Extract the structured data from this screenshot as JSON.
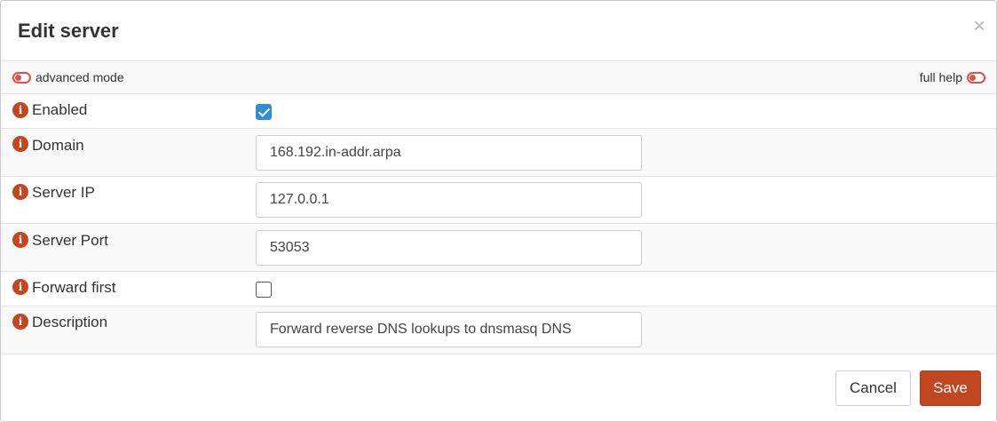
{
  "dialog": {
    "title": "Edit server",
    "close_glyph": "×"
  },
  "mode_bar": {
    "advanced_mode_label": "advanced mode",
    "full_help_label": "full help",
    "advanced_mode_on": false,
    "full_help_on": false
  },
  "fields": {
    "enabled": {
      "label": "Enabled",
      "checked": true
    },
    "domain": {
      "label": "Domain",
      "value": "168.192.in-addr.arpa"
    },
    "server_ip": {
      "label": "Server IP",
      "value": "127.0.0.1"
    },
    "server_port": {
      "label": "Server Port",
      "value": "53053"
    },
    "forward_first": {
      "label": "Forward first",
      "checked": false
    },
    "description": {
      "label": "Description",
      "value": "Forward reverse DNS lookups to dnsmasq DNS"
    }
  },
  "info_icon_glyph": "i",
  "buttons": {
    "cancel": "Cancel",
    "save": "Save"
  },
  "colors": {
    "accent": "#c2461f",
    "toggle": "#e0504a",
    "checkbox_checked": "#2f8cd6"
  },
  "icons": {
    "info": "info-icon",
    "close": "close-icon",
    "toggle": "toggle-icon"
  }
}
